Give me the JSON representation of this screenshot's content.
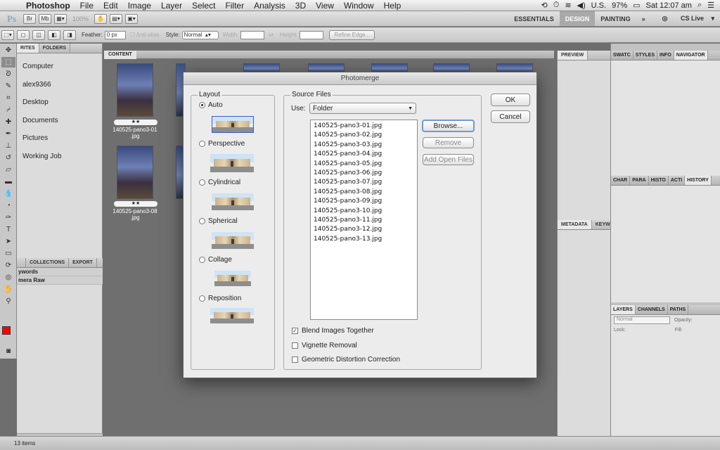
{
  "menubar": {
    "app_name": "Photoshop",
    "items": [
      "File",
      "Edit",
      "Image",
      "Layer",
      "Select",
      "Filter",
      "Analysis",
      "3D",
      "View",
      "Window",
      "Help"
    ],
    "status_right": {
      "input": "U.S.",
      "battery": "97%",
      "clock": "Sat 12:07 am"
    }
  },
  "appbar": {
    "logo": "Ps",
    "br_label": "Br",
    "mb_label": "Mb",
    "zoom": "100%",
    "workspaces": [
      "ESSENTIALS",
      "DESIGN",
      "PAINTING",
      "»"
    ],
    "active_workspace": "DESIGN",
    "cslive": "CS Live"
  },
  "options": {
    "feather_label": "Feather:",
    "feather_value": "0 px",
    "antialias": "Anti-alias",
    "style_label": "Style:",
    "style_value": "Normal",
    "width_label": "Width:",
    "height_label": "Height:",
    "refine_edge": "Refine Edge..."
  },
  "left_panel": {
    "tabs": [
      "RITES",
      "FOLDERS"
    ],
    "favorites": [
      "Computer",
      "alex9366",
      "Desktop",
      "Documents",
      "Pictures",
      "Working Job"
    ],
    "collection_tabs": [
      "COLLECTIONS",
      "EXPORT"
    ],
    "keyword_rows": [
      "ywords",
      "mera Raw"
    ]
  },
  "content": {
    "tab": "CONTENT",
    "thumbs": [
      {
        "caption": "140525-pano3-01 .jpg",
        "stars": "★★"
      },
      {
        "caption": "140525-pano3-08 .jpg",
        "stars": "★★"
      }
    ],
    "status": "13 items"
  },
  "right_panels": {
    "preview_tab": "PREVIEW",
    "metadata_tabs": [
      "METADATA",
      "KEYW"
    ],
    "top_tabs": [
      "SWATC",
      "STYLES",
      "INFO",
      "NAVIGATOR"
    ],
    "mid_tabs": [
      "CHAR",
      "PARA",
      "HISTO",
      "ACTI",
      "HISTORY"
    ],
    "layer_tabs": [
      "LAYERS",
      "CHANNELS",
      "PATHS"
    ],
    "blend_mode": "Normal",
    "opacity_label": "Opacity:",
    "lock_label": "Lock:",
    "fill_label": "Fill:"
  },
  "dialog": {
    "title": "Photomerge",
    "layout_title": "Layout",
    "layouts": [
      {
        "label": "Auto",
        "selected": true
      },
      {
        "label": "Perspective",
        "selected": false
      },
      {
        "label": "Cylindrical",
        "selected": false
      },
      {
        "label": "Spherical",
        "selected": false
      },
      {
        "label": "Collage",
        "selected": false
      },
      {
        "label": "Reposition",
        "selected": false
      }
    ],
    "source_title": "Source Files",
    "use_label": "Use:",
    "use_value": "Folder",
    "files": [
      "140525-pano3-01.jpg",
      "140525-pano3-02.jpg",
      "140525-pano3-03.jpg",
      "140525-pano3-04.jpg",
      "140525-pano3-05.jpg",
      "140525-pano3-06.jpg",
      "140525-pano3-07.jpg",
      "140525-pano3-08.jpg",
      "140525-pano3-09.jpg",
      "140525-pano3-10.jpg",
      "140525-pano3-11.jpg",
      "140525-pano3-12.jpg",
      "140525-pano3-13.jpg"
    ],
    "browse": "Browse...",
    "remove": "Remove",
    "add_open_files": "Add Open Files",
    "ok": "OK",
    "cancel": "Cancel",
    "blend_images": "Blend Images Together",
    "vignette": "Vignette Removal",
    "geometric": "Geometric Distortion Correction",
    "blend_checked": true,
    "vignette_checked": false,
    "geometric_checked": false
  }
}
